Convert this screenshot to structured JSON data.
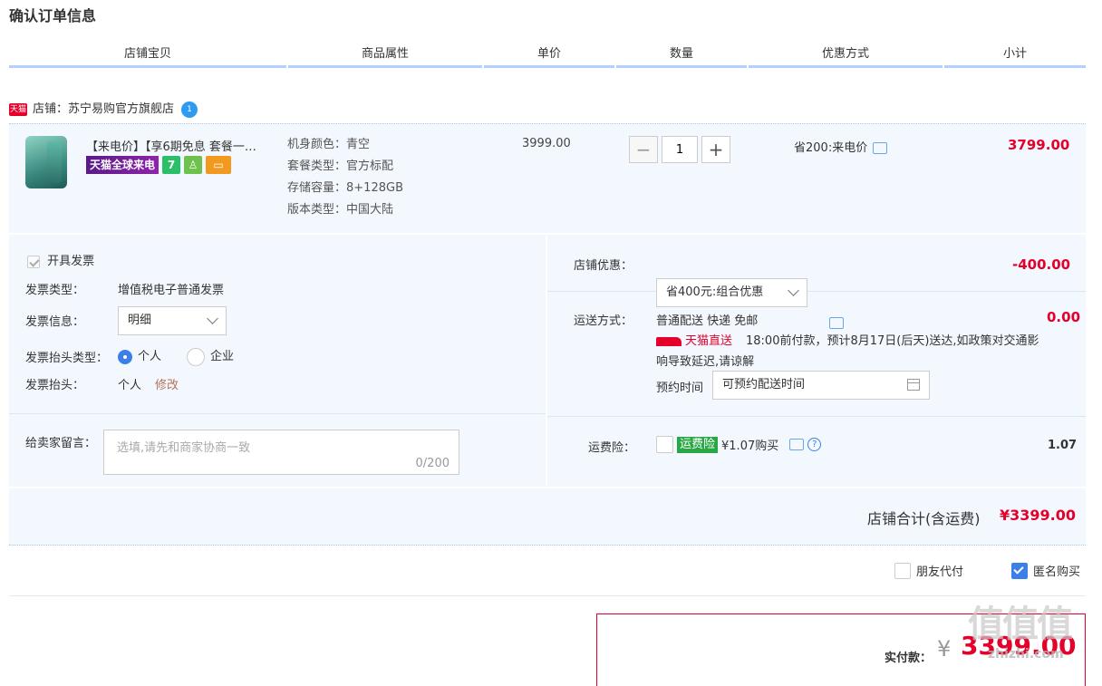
{
  "page_title": "确认订单信息",
  "columns": [
    "店铺宝贝",
    "商品属性",
    "单价",
    "数量",
    "优惠方式",
    "小计"
  ],
  "store": {
    "badge": "天猫",
    "label": "店铺：苏宁易购官方旗舰店",
    "ww": "1"
  },
  "item": {
    "title": "【来电价】【享6期免息 套餐一…",
    "tags": [
      "天猫全球来电",
      "7",
      "",
      ""
    ],
    "attributes": [
      {
        "k": "机身颜色：",
        "v": "青空"
      },
      {
        "k": "套餐类型：",
        "v": "官方标配"
      },
      {
        "k": "存储容量：",
        "v": "8+128GB"
      },
      {
        "k": "版本类型：",
        "v": "中国大陆"
      }
    ],
    "unit_price": "3999.00",
    "quantity": "1",
    "minus": "−",
    "plus": "+",
    "promo": "省200:来电价",
    "subtotal": "3799.00"
  },
  "invoice": {
    "checkbox_label": "开具发票",
    "type_label": "发票类型：",
    "type_value": "增值税电子普通发票",
    "info_label": "发票信息：",
    "info_value": "明细",
    "title_type_label": "发票抬头类型：",
    "opt_personal": "个人",
    "opt_company": "企业",
    "title_label": "发票抬头：",
    "title_value": "个人",
    "modify": "修改"
  },
  "message": {
    "label": "给卖家留言：",
    "placeholder": "选填,请先和商家协商一致",
    "counter": "0/200"
  },
  "store_discount": {
    "label": "店铺优惠：",
    "value": "省400元:组合优惠",
    "amount": "-400.00"
  },
  "shipping": {
    "label": "运送方式：",
    "method": "普通配送 快递 免邮",
    "amount": "0.00",
    "tmall_direct": "天猫直送",
    "notice_line1": "18:00前付款，预计8月17日(后天)送达,如政策对交通影",
    "notice_line2": "响导致延迟,请谅解",
    "appoint_label": "预约时间",
    "appoint_value": "可预约配送时间"
  },
  "insurance": {
    "label": "运费险：",
    "tag": "运费险",
    "price": "¥1.07购买",
    "amount": "1.07",
    "help": "?"
  },
  "store_total": {
    "label": "店铺合计(含运费)",
    "amount": "¥3399.00"
  },
  "options": {
    "friend_pay": "朋友代付",
    "anonymous": "匿名购买"
  },
  "payment": {
    "label": "实付款：",
    "currency": "¥",
    "amount": "3399.00"
  },
  "watermark": {
    "top": "值值值",
    "bottom": "zhizhi.com"
  },
  "colors": {
    "accent_red": "#e4002b",
    "header_line": "#b2d1ff",
    "panel_bg": "#f3f8fe",
    "primary_blue": "#3b7fe8"
  }
}
